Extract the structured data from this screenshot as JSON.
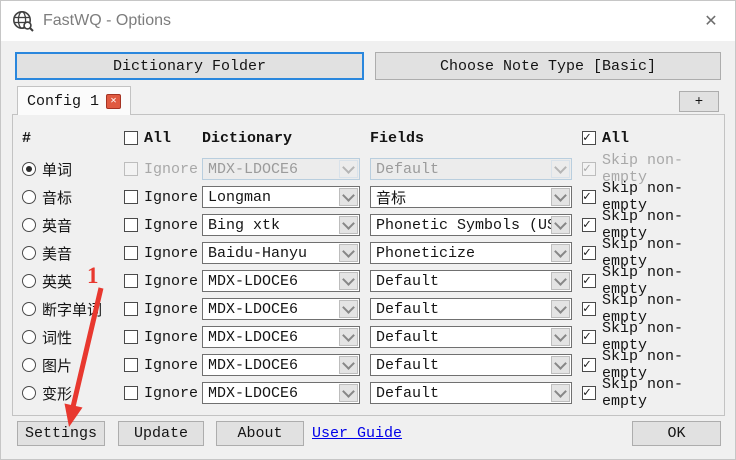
{
  "window": {
    "title": "FastWQ - Options",
    "close_glyph": "✕"
  },
  "toolbar": {
    "dictionary_folder_label": "Dictionary Folder",
    "choose_note_type_label": "Choose Note Type [Basic]"
  },
  "tabs": {
    "active_label": "Config 1",
    "close_glyph": "✕",
    "add_label": "+"
  },
  "table": {
    "headers": {
      "hash": "#",
      "all_left": "All",
      "dictionary": "Dictionary",
      "fields": "Fields",
      "all_right": "All"
    },
    "all_left_checked": false,
    "all_right_checked": true,
    "ignore_label": "Ignore",
    "skip_label": "Skip non-empty",
    "rows": [
      {
        "label": "单词",
        "selected": true,
        "disabled": true,
        "ignore_checked": false,
        "dictionary": "MDX-LDOCE6",
        "field": "Default",
        "skip_checked": true
      },
      {
        "label": "音标",
        "selected": false,
        "disabled": false,
        "ignore_checked": false,
        "dictionary": "Longman",
        "field": "音标",
        "skip_checked": true
      },
      {
        "label": "英音",
        "selected": false,
        "disabled": false,
        "ignore_checked": false,
        "dictionary": "Bing xtk",
        "field": "Phonetic Symbols (US)",
        "skip_checked": true
      },
      {
        "label": "美音",
        "selected": false,
        "disabled": false,
        "ignore_checked": false,
        "dictionary": "Baidu-Hanyu",
        "field": "Phoneticize",
        "skip_checked": true
      },
      {
        "label": "英英",
        "selected": false,
        "disabled": false,
        "ignore_checked": false,
        "dictionary": "MDX-LDOCE6",
        "field": "Default",
        "skip_checked": true
      },
      {
        "label": "断字单词",
        "selected": false,
        "disabled": false,
        "ignore_checked": false,
        "dictionary": "MDX-LDOCE6",
        "field": "Default",
        "skip_checked": true
      },
      {
        "label": "词性",
        "selected": false,
        "disabled": false,
        "ignore_checked": false,
        "dictionary": "MDX-LDOCE6",
        "field": "Default",
        "skip_checked": true
      },
      {
        "label": "图片",
        "selected": false,
        "disabled": false,
        "ignore_checked": false,
        "dictionary": "MDX-LDOCE6",
        "field": "Default",
        "skip_checked": true
      },
      {
        "label": "变形",
        "selected": false,
        "disabled": false,
        "ignore_checked": false,
        "dictionary": "MDX-LDOCE6",
        "field": "Default",
        "skip_checked": true
      }
    ]
  },
  "footer": {
    "settings_label": "Settings",
    "update_label": "Update",
    "about_label": "About",
    "user_guide_label": "User Guide",
    "ok_label": "OK"
  },
  "annotation": {
    "step_number": "1",
    "color": "#e8382f"
  },
  "colors": {
    "focus_border": "#2a87dd",
    "button_face": "#e1e1e1",
    "button_border": "#adadad",
    "link_blue": "#0000e8",
    "tab_close_red": "#e05a41",
    "window_bg": "#f0f0f0",
    "titlebar_bg": "#ffffff"
  }
}
